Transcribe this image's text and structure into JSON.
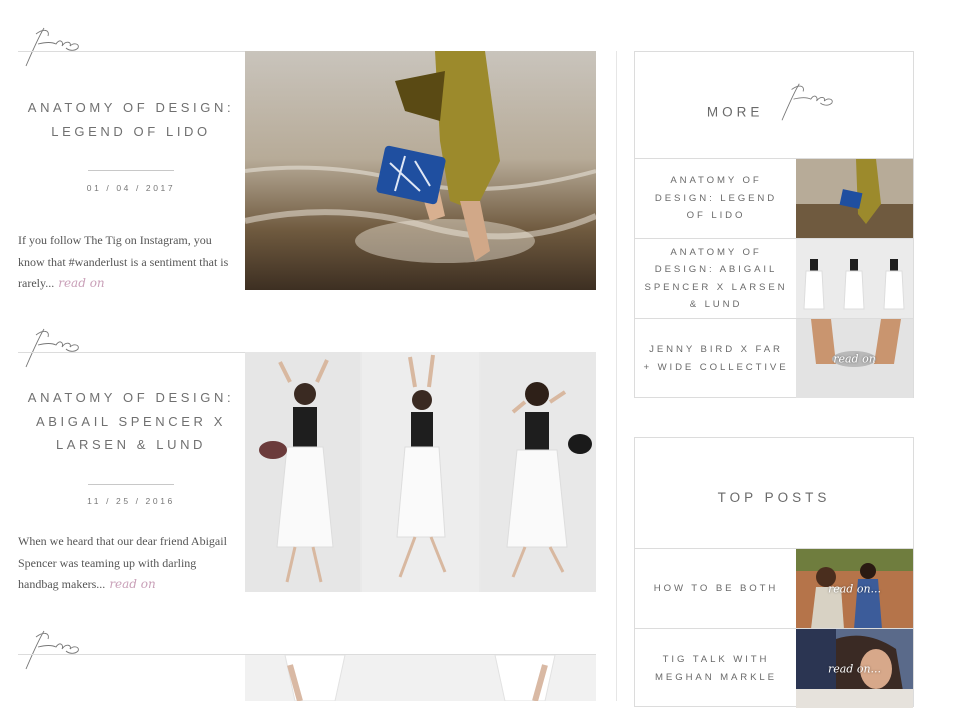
{
  "posts": [
    {
      "title": "ANATOMY OF DESIGN: LEGEND OF LIDO",
      "date": "01 / 04 / 2017",
      "excerpt": "If you follow The Tig on Instagram, you know that #wanderlust is a sentiment that is rarely...",
      "read_on": "read on"
    },
    {
      "title": "ANATOMY OF DESIGN: ABIGAIL SPENCER X LARSEN & LUND",
      "date": "11 / 25 / 2016",
      "excerpt": "When we heard that our dear friend Abigail Spencer was teaming up with darling handbag makers...",
      "read_on": "read on"
    }
  ],
  "sidebar": {
    "more_label": "MORE",
    "more_items": [
      {
        "label": "ANATOMY OF DESIGN: LEGEND OF LIDO"
      },
      {
        "label": "ANATOMY OF DESIGN: ABIGAIL SPENCER X LARSEN & LUND"
      },
      {
        "label": "JENNY BIRD X FAR + WIDE COLLECTIVE",
        "overlay": "read on"
      }
    ],
    "top_posts_label": "TOP POSTS",
    "top_items": [
      {
        "label": "HOW TO BE BOTH",
        "overlay": "read on..."
      },
      {
        "label": "TIG TALK WITH MEGHAN MARKLE",
        "overlay": "read on..."
      }
    ]
  },
  "logo_icon": "fashion-script-logo-icon"
}
